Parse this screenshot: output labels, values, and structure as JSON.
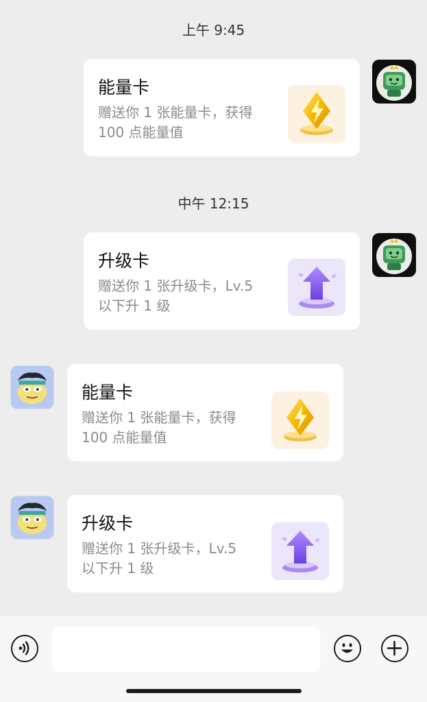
{
  "messages": [
    {
      "time": "上午 9:45",
      "title": "能量卡",
      "desc": "赠送你 1 张能量卡，获得 100 点能量值",
      "thumb_icon": "energy-card-icon",
      "sender": "self"
    },
    {
      "time": "中午 12:15",
      "title": "升级卡",
      "desc": "赠送你 1 张升级卡，Lv.5 以下升 1 级",
      "thumb_icon": "upgrade-card-icon",
      "sender": "self"
    },
    {
      "title": "能量卡",
      "desc": "赠送你 1 张能量卡，获得 100 点能量值",
      "thumb_icon": "energy-card-icon",
      "sender": "other"
    },
    {
      "title": "升级卡",
      "desc": "赠送你 1 张升级卡，Lv.5 以下升 1 级",
      "thumb_icon": "upgrade-card-icon",
      "sender": "other"
    }
  ],
  "input_bar": {
    "voice_icon": "voice-icon",
    "emoji_icon": "emoji-icon",
    "plus_icon": "plus-icon",
    "input_value": ""
  },
  "colors": {
    "background": "#ededed",
    "card": "#ffffff",
    "energy_accent": "#f2b705",
    "upgrade_accent": "#8a5cf0"
  }
}
